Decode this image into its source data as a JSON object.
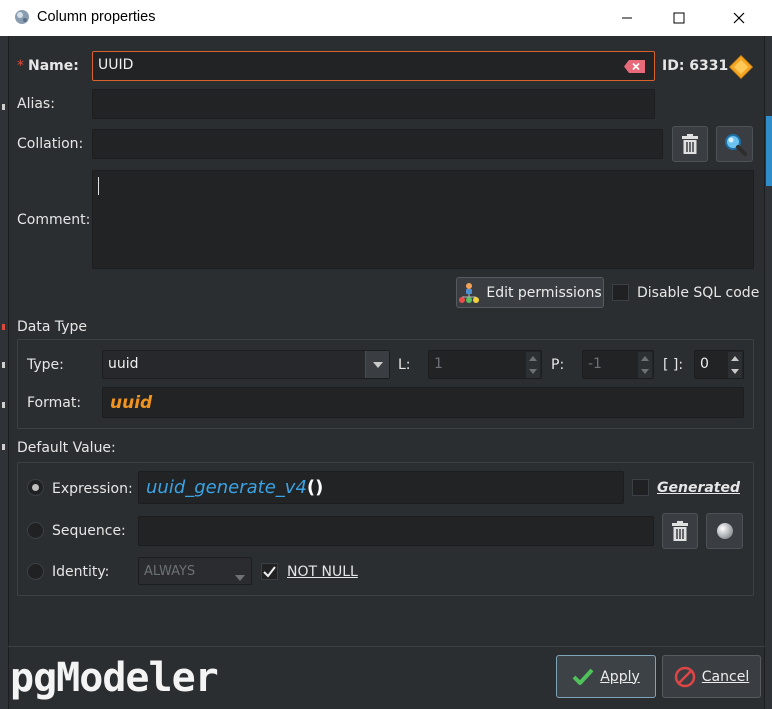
{
  "window": {
    "title": "Column properties",
    "minimize_icon": "minimize-icon",
    "maximize_icon": "maximize-icon",
    "close_icon": "close-icon"
  },
  "form": {
    "name_label": "Name:",
    "name_required_marker": "*",
    "name_value": "UUID",
    "id_label": "ID: 6331",
    "alias_label": "Alias:",
    "alias_value": "",
    "collation_label": "Collation:",
    "collation_value": "",
    "comment_label": "Comment:",
    "comment_value": "",
    "edit_permissions_label": "Edit permissions",
    "disable_sql_label": "Disable SQL code",
    "disable_sql_checked": false
  },
  "data_type": {
    "section_label": "Data Type",
    "type_label": "Type:",
    "type_value": "uuid",
    "length_label": "L:",
    "length_value": "1",
    "precision_label": "P:",
    "precision_value": "-1",
    "dimension_label": "[ ]:",
    "dimension_value": "0",
    "format_label": "Format:",
    "format_value": "uuid"
  },
  "default_value": {
    "section_label": "Default Value:",
    "expression_label": "Expression:",
    "expression_func": "uuid_generate_v4",
    "expression_parens": "()",
    "generated_label": "Generated",
    "generated_checked": false,
    "sequence_label": "Sequence:",
    "sequence_value": "",
    "identity_label": "Identity:",
    "identity_value": "ALWAYS",
    "not_null_label": "NOT NULL",
    "not_null_checked": true,
    "selected_option": "expression"
  },
  "footer": {
    "logo_text": "pgModeler",
    "apply_label": "Apply",
    "cancel_label": "Cancel"
  },
  "colors": {
    "background": "#2b2e31",
    "focus_border": "#d9622c",
    "format_text": "#f0931f",
    "expression_text": "#3aa3e3",
    "required_marker": "#e04c3c"
  }
}
